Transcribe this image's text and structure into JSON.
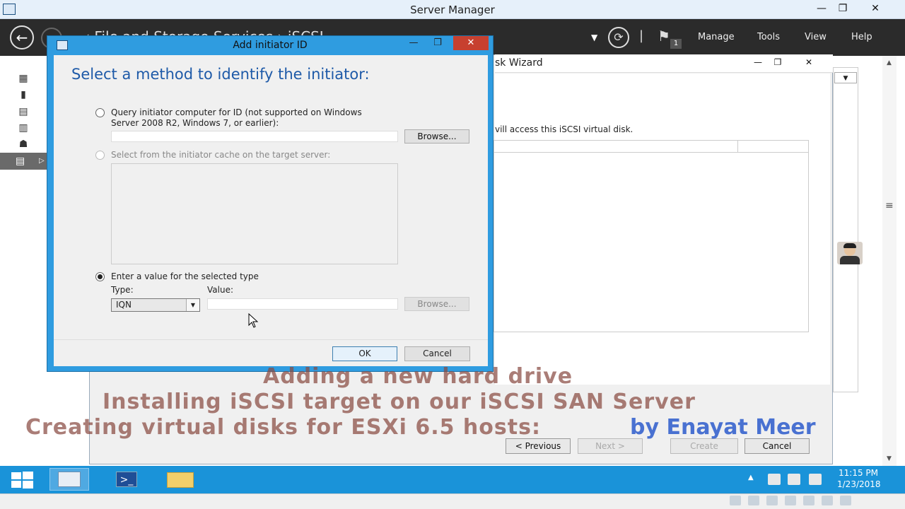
{
  "server_manager": {
    "title": "Server Manager",
    "breadcrumb": "·· ‹ File and Storage Services › iSCSI",
    "menu": [
      "Manage",
      "Tools",
      "View",
      "Help"
    ],
    "flag_count": "1",
    "window_controls": {
      "minimize": "—",
      "maximize": "❐",
      "close": "✕"
    }
  },
  "wizard": {
    "title": "sk Wizard",
    "text": "vill access this iSCSI virtual disk.",
    "buttons": {
      "previous": "< Previous",
      "next": "Next >",
      "create": "Create",
      "cancel": "Cancel"
    }
  },
  "dialog": {
    "title": "Add initiator ID",
    "heading": "Select a method to identify the initiator:",
    "options": {
      "query_line1": "Query initiator computer for ID (not supported on Windows",
      "query_line2": "Server 2008 R2, Windows 7, or earlier):",
      "cache": "Select from the initiator cache on the target server:",
      "enter_value": "Enter a value for the selected type"
    },
    "selected_option": "enter_value",
    "browse_label": "Browse...",
    "type_label": "Type:",
    "value_label": "Value:",
    "type_selected": "IQN",
    "value_input": "",
    "ok": "OK",
    "cancel": "Cancel"
  },
  "captions": {
    "line1": "Adding a new hard drive",
    "line2": "Installing iSCSI target on our iSCSI SAN Server",
    "line3": "Creating virtual disks for ESXi 6.5  hosts:",
    "byline": "by Enayat Meer"
  },
  "taskbar": {
    "time": "11:15 PM",
    "date": "1/23/2018"
  },
  "colors": {
    "accent": "#1a93d9",
    "dialog_frame": "#2f9ce0",
    "close_button": "#c7402f",
    "heading": "#1e5aa8",
    "caption": "#8a4c43",
    "byline": "#2d5ccc"
  }
}
